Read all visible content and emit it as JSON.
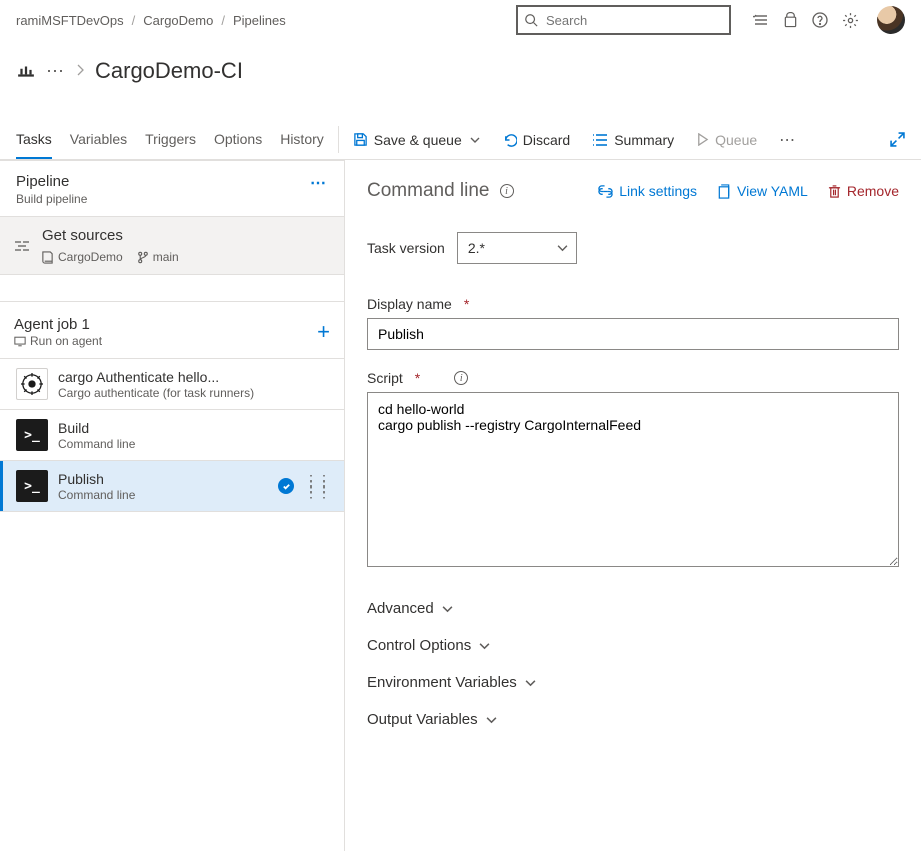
{
  "breadcrumbs": {
    "org": "ramiMSFTDevOps",
    "project": "CargoDemo",
    "section": "Pipelines"
  },
  "search": {
    "placeholder": "Search"
  },
  "page_title": "CargoDemo-CI",
  "tabs": {
    "tasks": "Tasks",
    "variables": "Variables",
    "triggers": "Triggers",
    "options": "Options",
    "history": "History"
  },
  "toolbar": {
    "save_queue": "Save & queue",
    "discard": "Discard",
    "summary": "Summary",
    "queue": "Queue"
  },
  "pipeline_header": {
    "title": "Pipeline",
    "subtitle": "Build pipeline"
  },
  "get_sources": {
    "title": "Get sources",
    "repo": "CargoDemo",
    "branch": "main"
  },
  "agent_job": {
    "title": "Agent job 1",
    "subtitle": "Run on agent"
  },
  "tasks_list": [
    {
      "title": "cargo Authenticate hello...",
      "subtitle": "Cargo authenticate (for task runners)",
      "kind": "rust"
    },
    {
      "title": "Build",
      "subtitle": "Command line",
      "kind": "cmd"
    },
    {
      "title": "Publish",
      "subtitle": "Command line",
      "kind": "cmd",
      "selected": true
    }
  ],
  "right": {
    "heading": "Command line",
    "link_settings": "Link settings",
    "view_yaml": "View YAML",
    "remove": "Remove",
    "task_version_label": "Task version",
    "task_version_value": "2.*",
    "display_name_label": "Display name",
    "display_name_value": "Publish",
    "script_label": "Script",
    "script_value": "cd hello-world\ncargo publish --registry CargoInternalFeed",
    "advanced": "Advanced",
    "control_options": "Control Options",
    "env_vars": "Environment Variables",
    "output_vars": "Output Variables"
  }
}
